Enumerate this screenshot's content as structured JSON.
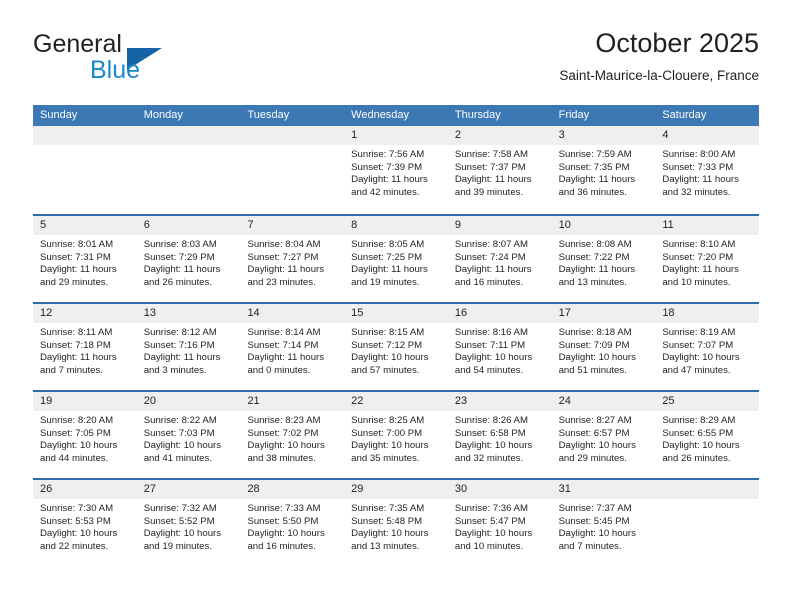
{
  "brand": {
    "name_part1": "General",
    "name_part2": "Blue",
    "logo_icon": "triangle-logo-icon"
  },
  "header": {
    "title": "October 2025",
    "subtitle": "Saint-Maurice-la-Clouere, France"
  },
  "colors": {
    "header_blue": "#3b78b4",
    "week_separator_blue": "#2e6da9",
    "day_band_gray": "#efefef",
    "brand_blue": "#1b87c9",
    "logo_blue": "#1565a6",
    "text": "#231f20"
  },
  "calendar": {
    "weekday_headers": [
      "Sunday",
      "Monday",
      "Tuesday",
      "Wednesday",
      "Thursday",
      "Friday",
      "Saturday"
    ],
    "labels": {
      "sunrise": "Sunrise:",
      "sunset": "Sunset:",
      "daylight": "Daylight:"
    },
    "weeks": [
      [
        {
          "day": "",
          "empty": true
        },
        {
          "day": "",
          "empty": true
        },
        {
          "day": "",
          "empty": true
        },
        {
          "day": "1",
          "sunrise": "Sunrise: 7:56 AM",
          "sunset": "Sunset: 7:39 PM",
          "daylight_line1": "Daylight: 11 hours",
          "daylight_line2": "and 42 minutes."
        },
        {
          "day": "2",
          "sunrise": "Sunrise: 7:58 AM",
          "sunset": "Sunset: 7:37 PM",
          "daylight_line1": "Daylight: 11 hours",
          "daylight_line2": "and 39 minutes."
        },
        {
          "day": "3",
          "sunrise": "Sunrise: 7:59 AM",
          "sunset": "Sunset: 7:35 PM",
          "daylight_line1": "Daylight: 11 hours",
          "daylight_line2": "and 36 minutes."
        },
        {
          "day": "4",
          "sunrise": "Sunrise: 8:00 AM",
          "sunset": "Sunset: 7:33 PM",
          "daylight_line1": "Daylight: 11 hours",
          "daylight_line2": "and 32 minutes."
        }
      ],
      [
        {
          "day": "5",
          "sunrise": "Sunrise: 8:01 AM",
          "sunset": "Sunset: 7:31 PM",
          "daylight_line1": "Daylight: 11 hours",
          "daylight_line2": "and 29 minutes."
        },
        {
          "day": "6",
          "sunrise": "Sunrise: 8:03 AM",
          "sunset": "Sunset: 7:29 PM",
          "daylight_line1": "Daylight: 11 hours",
          "daylight_line2": "and 26 minutes."
        },
        {
          "day": "7",
          "sunrise": "Sunrise: 8:04 AM",
          "sunset": "Sunset: 7:27 PM",
          "daylight_line1": "Daylight: 11 hours",
          "daylight_line2": "and 23 minutes."
        },
        {
          "day": "8",
          "sunrise": "Sunrise: 8:05 AM",
          "sunset": "Sunset: 7:25 PM",
          "daylight_line1": "Daylight: 11 hours",
          "daylight_line2": "and 19 minutes."
        },
        {
          "day": "9",
          "sunrise": "Sunrise: 8:07 AM",
          "sunset": "Sunset: 7:24 PM",
          "daylight_line1": "Daylight: 11 hours",
          "daylight_line2": "and 16 minutes."
        },
        {
          "day": "10",
          "sunrise": "Sunrise: 8:08 AM",
          "sunset": "Sunset: 7:22 PM",
          "daylight_line1": "Daylight: 11 hours",
          "daylight_line2": "and 13 minutes."
        },
        {
          "day": "11",
          "sunrise": "Sunrise: 8:10 AM",
          "sunset": "Sunset: 7:20 PM",
          "daylight_line1": "Daylight: 11 hours",
          "daylight_line2": "and 10 minutes."
        }
      ],
      [
        {
          "day": "12",
          "sunrise": "Sunrise: 8:11 AM",
          "sunset": "Sunset: 7:18 PM",
          "daylight_line1": "Daylight: 11 hours",
          "daylight_line2": "and 7 minutes."
        },
        {
          "day": "13",
          "sunrise": "Sunrise: 8:12 AM",
          "sunset": "Sunset: 7:16 PM",
          "daylight_line1": "Daylight: 11 hours",
          "daylight_line2": "and 3 minutes."
        },
        {
          "day": "14",
          "sunrise": "Sunrise: 8:14 AM",
          "sunset": "Sunset: 7:14 PM",
          "daylight_line1": "Daylight: 11 hours",
          "daylight_line2": "and 0 minutes."
        },
        {
          "day": "15",
          "sunrise": "Sunrise: 8:15 AM",
          "sunset": "Sunset: 7:12 PM",
          "daylight_line1": "Daylight: 10 hours",
          "daylight_line2": "and 57 minutes."
        },
        {
          "day": "16",
          "sunrise": "Sunrise: 8:16 AM",
          "sunset": "Sunset: 7:11 PM",
          "daylight_line1": "Daylight: 10 hours",
          "daylight_line2": "and 54 minutes."
        },
        {
          "day": "17",
          "sunrise": "Sunrise: 8:18 AM",
          "sunset": "Sunset: 7:09 PM",
          "daylight_line1": "Daylight: 10 hours",
          "daylight_line2": "and 51 minutes."
        },
        {
          "day": "18",
          "sunrise": "Sunrise: 8:19 AM",
          "sunset": "Sunset: 7:07 PM",
          "daylight_line1": "Daylight: 10 hours",
          "daylight_line2": "and 47 minutes."
        }
      ],
      [
        {
          "day": "19",
          "sunrise": "Sunrise: 8:20 AM",
          "sunset": "Sunset: 7:05 PM",
          "daylight_line1": "Daylight: 10 hours",
          "daylight_line2": "and 44 minutes."
        },
        {
          "day": "20",
          "sunrise": "Sunrise: 8:22 AM",
          "sunset": "Sunset: 7:03 PM",
          "daylight_line1": "Daylight: 10 hours",
          "daylight_line2": "and 41 minutes."
        },
        {
          "day": "21",
          "sunrise": "Sunrise: 8:23 AM",
          "sunset": "Sunset: 7:02 PM",
          "daylight_line1": "Daylight: 10 hours",
          "daylight_line2": "and 38 minutes."
        },
        {
          "day": "22",
          "sunrise": "Sunrise: 8:25 AM",
          "sunset": "Sunset: 7:00 PM",
          "daylight_line1": "Daylight: 10 hours",
          "daylight_line2": "and 35 minutes."
        },
        {
          "day": "23",
          "sunrise": "Sunrise: 8:26 AM",
          "sunset": "Sunset: 6:58 PM",
          "daylight_line1": "Daylight: 10 hours",
          "daylight_line2": "and 32 minutes."
        },
        {
          "day": "24",
          "sunrise": "Sunrise: 8:27 AM",
          "sunset": "Sunset: 6:57 PM",
          "daylight_line1": "Daylight: 10 hours",
          "daylight_line2": "and 29 minutes."
        },
        {
          "day": "25",
          "sunrise": "Sunrise: 8:29 AM",
          "sunset": "Sunset: 6:55 PM",
          "daylight_line1": "Daylight: 10 hours",
          "daylight_line2": "and 26 minutes."
        }
      ],
      [
        {
          "day": "26",
          "sunrise": "Sunrise: 7:30 AM",
          "sunset": "Sunset: 5:53 PM",
          "daylight_line1": "Daylight: 10 hours",
          "daylight_line2": "and 22 minutes."
        },
        {
          "day": "27",
          "sunrise": "Sunrise: 7:32 AM",
          "sunset": "Sunset: 5:52 PM",
          "daylight_line1": "Daylight: 10 hours",
          "daylight_line2": "and 19 minutes."
        },
        {
          "day": "28",
          "sunrise": "Sunrise: 7:33 AM",
          "sunset": "Sunset: 5:50 PM",
          "daylight_line1": "Daylight: 10 hours",
          "daylight_line2": "and 16 minutes."
        },
        {
          "day": "29",
          "sunrise": "Sunrise: 7:35 AM",
          "sunset": "Sunset: 5:48 PM",
          "daylight_line1": "Daylight: 10 hours",
          "daylight_line2": "and 13 minutes."
        },
        {
          "day": "30",
          "sunrise": "Sunrise: 7:36 AM",
          "sunset": "Sunset: 5:47 PM",
          "daylight_line1": "Daylight: 10 hours",
          "daylight_line2": "and 10 minutes."
        },
        {
          "day": "31",
          "sunrise": "Sunrise: 7:37 AM",
          "sunset": "Sunset: 5:45 PM",
          "daylight_line1": "Daylight: 10 hours",
          "daylight_line2": "and 7 minutes."
        },
        {
          "day": "",
          "empty": true
        }
      ]
    ]
  }
}
